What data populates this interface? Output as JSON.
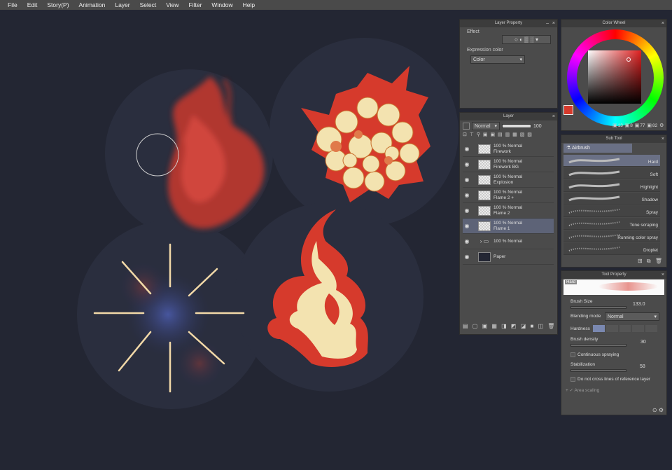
{
  "menu": [
    "File",
    "Edit",
    "Story(P)",
    "Animation",
    "Layer",
    "Select",
    "View",
    "Filter",
    "Window",
    "Help"
  ],
  "layer_property": {
    "title": "Layer Property",
    "effect_label": "Effect",
    "expression_color_label": "Expression color",
    "expression_color_value": "Color"
  },
  "layer_panel": {
    "title": "Layer",
    "blend_mode": "Normal",
    "opacity": "100",
    "layers": [
      {
        "line1": "100 % Normal",
        "line2": "Firework",
        "selected": false
      },
      {
        "line1": "100 % Normal",
        "line2": "Firework BG",
        "selected": false
      },
      {
        "line1": "100 % Normal",
        "line2": "Explosion",
        "selected": false
      },
      {
        "line1": "100 % Normal",
        "line2": "Flame 2 +",
        "selected": false
      },
      {
        "line1": "100 % Normal",
        "line2": "Flame 2",
        "selected": false
      },
      {
        "line1": "100 % Normal",
        "line2": "Flame 1",
        "selected": true
      },
      {
        "line1": "100 % Normal",
        "line2": "",
        "selected": false
      },
      {
        "line1": "Paper",
        "line2": "",
        "selected": false
      }
    ]
  },
  "color_wheel": {
    "title": "Color Wheel",
    "readout": {
      "h": "8",
      "s": "77",
      "v": "82",
      "mid": "13"
    },
    "main_color": "#d63a2c"
  },
  "sub_tool": {
    "title": "Sub Tool",
    "group": "Airbrush",
    "items": [
      "Hard",
      "Soft",
      "Highlight",
      "Shadow",
      "Spray",
      "Tone scraping",
      "Running color spray",
      "Droplet"
    ]
  },
  "tool_property": {
    "title": "Tool Property",
    "preview_label": "Hard",
    "brush_size_label": "Brush Size",
    "brush_size": "133.0",
    "blending_mode_label": "Blending mode",
    "blending_mode": "Normal",
    "hardness_label": "Hardness",
    "brush_density_label": "Brush density",
    "brush_density": "30",
    "continuous_spraying": "Continuous spraying",
    "stabilization_label": "Stabilization",
    "stabilization": "58",
    "do_not_cross": "Do not cross lines of reference layer",
    "area_scaling": "Area scaling"
  }
}
